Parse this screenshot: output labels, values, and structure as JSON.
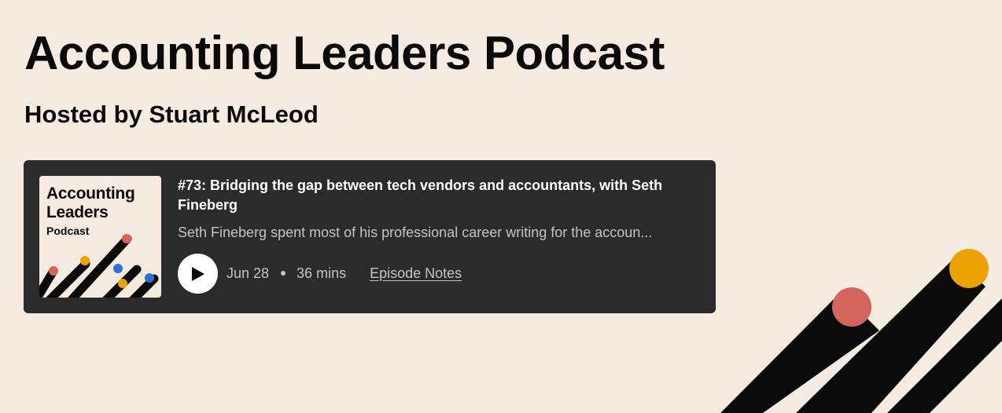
{
  "page": {
    "title": "Accounting Leaders Podcast",
    "host": "Hosted by Stuart McLeod"
  },
  "episode": {
    "title": "#73: Bridging the gap between tech vendors and accountants, with Seth Fineberg",
    "description": "Seth Fineberg spent most of his professional career writing for the accoun...",
    "date": "Jun 28",
    "duration": "36 mins",
    "notes_link": "Episode Notes",
    "cover": {
      "title_line1": "Accounting",
      "title_line2": "Leaders",
      "subtitle": "Podcast"
    }
  },
  "icons": {
    "play": "play-icon"
  },
  "colors": {
    "background": "#f6ebe1",
    "card": "#2b2b2b",
    "text_primary": "#0a0a0a",
    "text_muted": "#c4c4c4",
    "accent_red": "#d4655c",
    "accent_yellow": "#eba100",
    "accent_blue": "#2f6fd6"
  }
}
